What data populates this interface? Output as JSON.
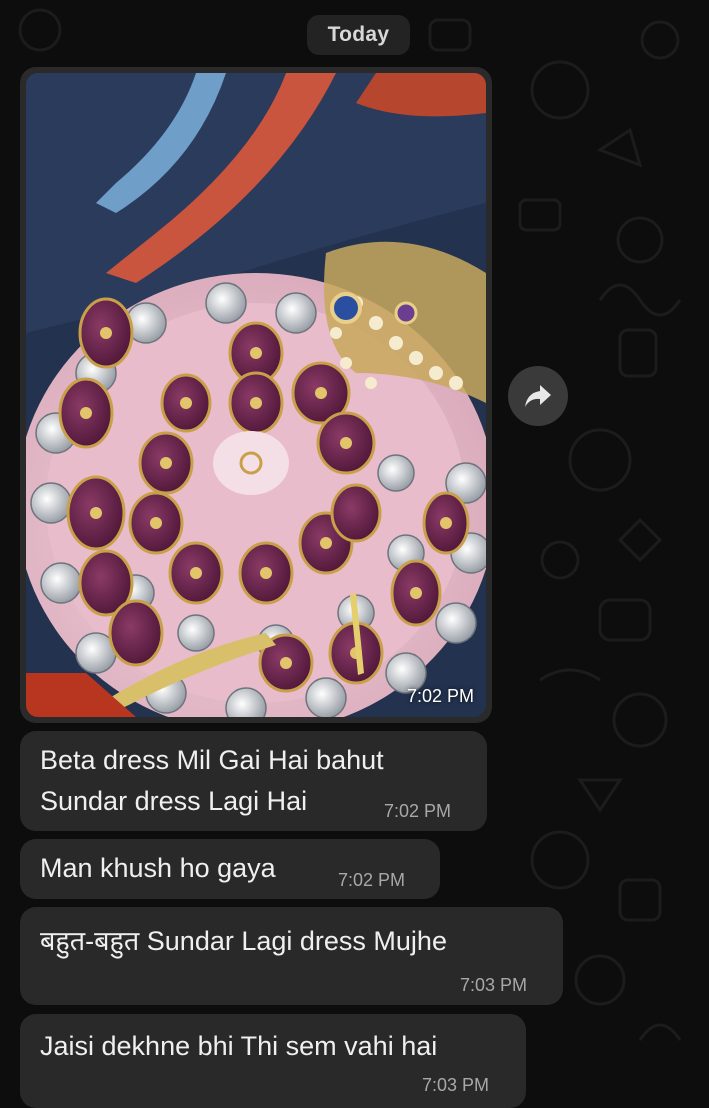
{
  "date_chip": "Today",
  "image_message": {
    "time": "7:02 PM"
  },
  "messages": [
    {
      "lines": [
        "Beta dress Mil Gai Hai bahut",
        "Sundar dress Lagi Hai"
      ],
      "time": "7:02 PM"
    },
    {
      "lines": [
        "Man khush ho gaya"
      ],
      "time": "7:02 PM"
    },
    {
      "lines": [
        "बहुत-बहुत Sundar Lagi dress Mujhe"
      ],
      "time": "7:03 PM"
    },
    {
      "lines": [
        "Jaisi dekhne bhi Thi sem vahi hai"
      ],
      "time": "7:03 PM"
    }
  ],
  "colors": {
    "background": "#0d0d0d",
    "bubble": "#292929",
    "date_chip": "#232323",
    "text": "#efefef",
    "timestamp": "#a8a8a8"
  },
  "icons": {
    "forward": "forward-arrow-icon"
  }
}
